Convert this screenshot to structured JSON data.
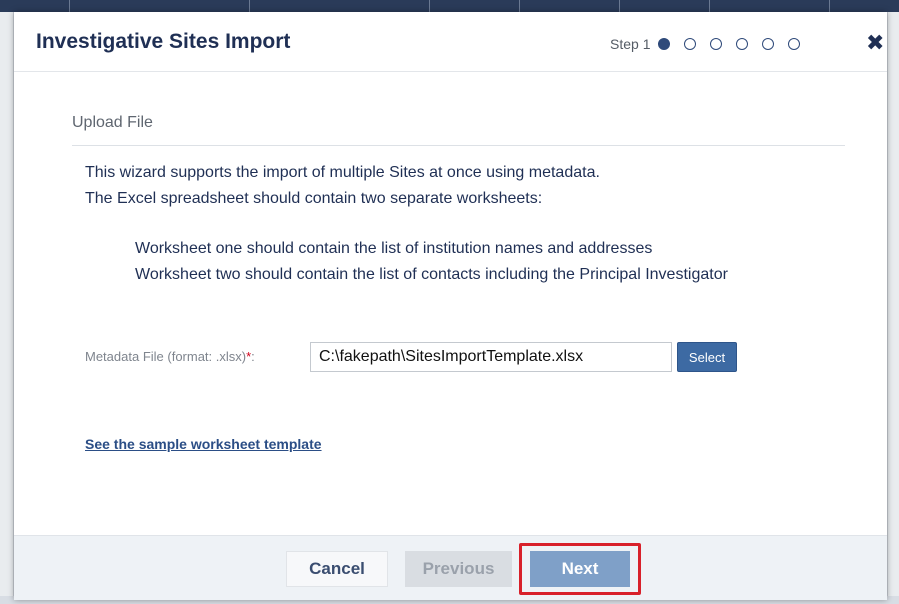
{
  "dialog": {
    "title": "Investigative Sites Import",
    "step_label": "Step 1",
    "steps_total": 6,
    "step_current": 1,
    "close_symbol": "✖"
  },
  "upload": {
    "section_title": "Upload File",
    "intro_line1": "This wizard supports the import of multiple Sites at once using metadata.",
    "intro_line2": "The Excel spreadsheet should contain two separate worksheets:",
    "worksheet1": "Worksheet one should contain the list of institution names and addresses",
    "worksheet2": "Worksheet two should contain the list of contacts including the Principal Investigator",
    "file_label": "Metadata File (format: .xlsx)",
    "required_mark": "*",
    "file_label_colon": ":",
    "file_value": "C:\\fakepath\\SitesImportTemplate.xlsx",
    "select_label": "Select",
    "sample_link": "See the sample worksheet template"
  },
  "footer": {
    "cancel_label": "Cancel",
    "previous_label": "Previous",
    "next_label": "Next"
  },
  "colors": {
    "primary": "#3d6aa3",
    "next_button": "#7fa0c8",
    "highlight": "#d8202a",
    "title_text": "#1f2f54"
  }
}
